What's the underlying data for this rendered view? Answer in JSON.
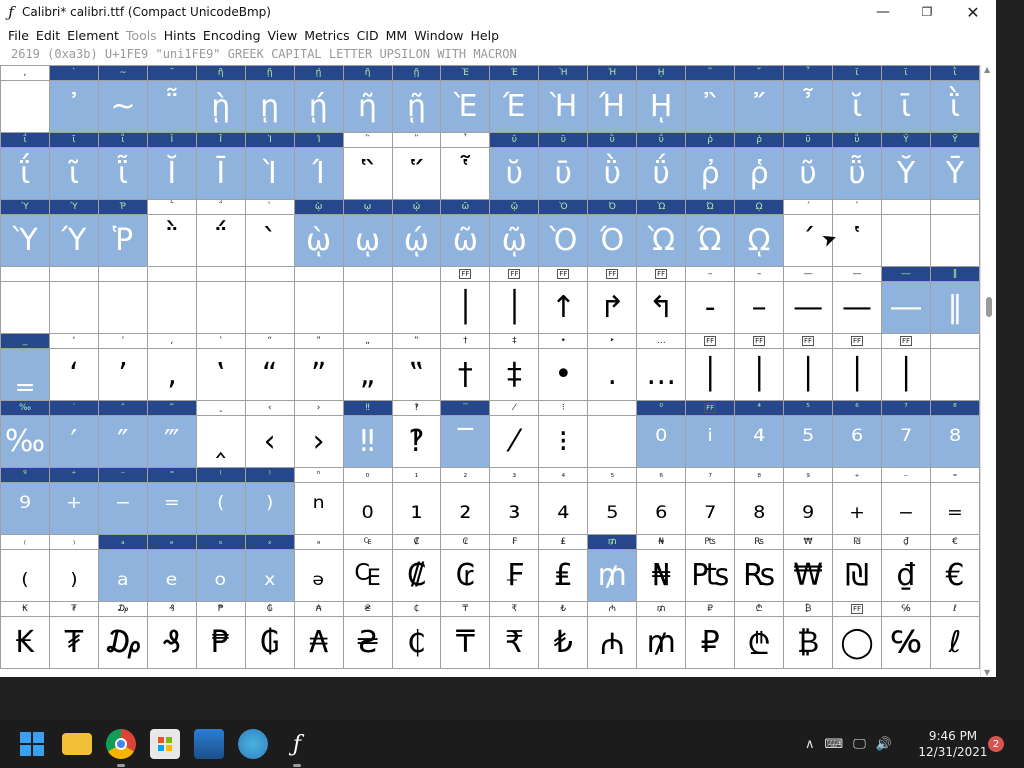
{
  "window": {
    "app_icon": "fontforge-icon",
    "title": "Calibri*  calibri.ttf (Compact UnicodeBmp)",
    "minimize_glyph": "—",
    "maximize_glyph": "❐",
    "close_glyph": "✕"
  },
  "menu": [
    {
      "label": "File",
      "enabled": true
    },
    {
      "label": "Edit",
      "enabled": true
    },
    {
      "label": "Element",
      "enabled": true
    },
    {
      "label": "Tools",
      "enabled": false
    },
    {
      "label": "Hints",
      "enabled": true
    },
    {
      "label": "Encoding",
      "enabled": true
    },
    {
      "label": "View",
      "enabled": true
    },
    {
      "label": "Metrics",
      "enabled": true
    },
    {
      "label": "CID",
      "enabled": true
    },
    {
      "label": "MM",
      "enabled": true
    },
    {
      "label": "Window",
      "enabled": true
    },
    {
      "label": "Help",
      "enabled": true
    }
  ],
  "info_line": "2619 (0xa3b) U+1FE9 \"uni1FE9\" GREEK CAPITAL LETTER UPSILON WITH MACRON",
  "grid": {
    "columns": 20,
    "rows": [
      {
        "labels": [
          ",",
          "`",
          "~",
          "῀",
          "ῆ",
          "ῇ",
          "ῄ",
          "ῆ",
          "ῇ",
          "Ὲ",
          "Έ",
          "Ὴ",
          "Ή",
          "ῌ",
          "῍",
          "῎",
          "῏",
          "ῐ",
          "ῑ",
          "ῒ"
        ],
        "glyphs": [
          "",
          "᾿",
          "~",
          "῁",
          "ῂ",
          "ῃ",
          "ῄ",
          "ῆ",
          "ῇ",
          "Ὲ",
          "Έ",
          "Ὴ",
          "Ή",
          "ῌ",
          "῍",
          "῎",
          "῏",
          "ῐ",
          "ῑ",
          "ῒ"
        ],
        "selected": [
          false,
          true,
          true,
          true,
          true,
          true,
          true,
          true,
          true,
          true,
          true,
          true,
          true,
          true,
          true,
          true,
          true,
          true,
          true,
          true
        ]
      },
      {
        "labels": [
          "ΐ",
          "ῖ",
          "ῗ",
          "Ῐ",
          "Ῑ",
          "Ὶ",
          "Ί",
          "῝",
          "῞",
          "῟",
          "ῠ",
          "ῡ",
          "ῢ",
          "ΰ",
          "ῤ",
          "ῥ",
          "ῦ",
          "ῧ",
          "Ῠ",
          "Ῡ"
        ],
        "glyphs": [
          "ΐ",
          "ῖ",
          "ῗ",
          "Ῐ",
          "Ῑ",
          "Ὶ",
          "Ί",
          "῝",
          "῞",
          "῟",
          "ῠ",
          "ῡ",
          "ῢ",
          "ΰ",
          "ῤ",
          "ῥ",
          "ῦ",
          "ῧ",
          "Ῠ",
          "Ῡ"
        ],
        "selected": [
          true,
          true,
          true,
          true,
          true,
          true,
          true,
          false,
          false,
          false,
          true,
          true,
          true,
          true,
          true,
          true,
          true,
          true,
          true,
          true
        ]
      },
      {
        "labels": [
          "Ὺ",
          "Ύ",
          "Ῥ",
          "῭",
          "΅",
          "`",
          "ῲ",
          "ῳ",
          "ῴ",
          "ῶ",
          "ῷ",
          "Ὸ",
          "Ό",
          "Ὼ",
          "Ώ",
          "ῼ",
          "´",
          "῾",
          "",
          ""
        ],
        "glyphs": [
          "Ὺ",
          "Ύ",
          "Ῥ",
          "῭",
          "΅",
          "`",
          "ῲ",
          "ῳ",
          "ῴ",
          "ῶ",
          "ῷ",
          "Ὸ",
          "Ό",
          "Ὼ",
          "Ώ",
          "ῼ",
          "´",
          "῾",
          "",
          ""
        ],
        "selected": [
          true,
          true,
          true,
          false,
          false,
          false,
          true,
          true,
          true,
          true,
          true,
          true,
          true,
          true,
          true,
          true,
          false,
          false,
          false,
          false
        ]
      },
      {
        "labels": [
          "",
          "",
          "",
          "",
          "",
          "",
          "",
          "",
          "",
          "FF",
          "FF",
          "FF",
          "FF",
          "FF",
          "–",
          "–",
          "—",
          "—",
          "―",
          "‖"
        ],
        "glyphs": [
          "",
          "",
          "",
          "",
          "",
          "",
          "",
          "",
          "",
          "│",
          "│",
          "↑",
          "↱",
          "↰",
          "-",
          "–",
          "—",
          "—",
          "―",
          "‖"
        ],
        "selected": [
          false,
          false,
          false,
          false,
          false,
          false,
          false,
          false,
          false,
          false,
          false,
          false,
          false,
          false,
          false,
          false,
          false,
          false,
          true,
          true
        ]
      },
      {
        "labels": [
          "_",
          "‘",
          "’",
          "‚",
          "‛",
          "“",
          "”",
          "„",
          "‟",
          "†",
          "‡",
          "•",
          "‣",
          "…",
          "FF",
          "FF",
          "FF",
          "FF",
          "FF",
          ""
        ],
        "glyphs": [
          "‗",
          "‘",
          "’",
          "‚",
          "‛",
          "“",
          "”",
          "„",
          "‟",
          "†",
          "‡",
          "•",
          ".",
          "…",
          "│",
          "│",
          "│",
          "│",
          "│",
          ""
        ],
        "selected": [
          true,
          false,
          false,
          false,
          false,
          false,
          false,
          false,
          false,
          false,
          false,
          false,
          false,
          false,
          false,
          false,
          false,
          false,
          false,
          false
        ]
      },
      {
        "labels": [
          "‰",
          "′",
          "″",
          "‴",
          "‸",
          "‹",
          "›",
          "‼",
          "‽",
          "‾",
          "⁄",
          "⁝",
          "",
          "⁰",
          "FF",
          "⁴",
          "⁵",
          "⁶",
          "⁷",
          "⁸"
        ],
        "glyphs": [
          "‰",
          "′",
          "″",
          "‴",
          "‸",
          "‹",
          "›",
          "‼",
          "‽",
          "‾",
          "⁄",
          "⁝",
          "",
          "⁰",
          "ⁱ",
          "⁴",
          "⁵",
          "⁶",
          "⁷",
          "⁸"
        ],
        "selected": [
          true,
          true,
          true,
          true,
          false,
          false,
          false,
          true,
          false,
          true,
          false,
          false,
          false,
          true,
          true,
          true,
          true,
          true,
          true,
          true
        ]
      },
      {
        "labels": [
          "⁹",
          "⁺",
          "⁻",
          "⁼",
          "⁽",
          "⁾",
          "ⁿ",
          "₀",
          "₁",
          "₂",
          "₃",
          "₄",
          "₅",
          "₆",
          "₇",
          "₈",
          "₉",
          "₊",
          "₋",
          "₌"
        ],
        "glyphs": [
          "⁹",
          "⁺",
          "⁻",
          "⁼",
          "⁽",
          "⁾",
          "ⁿ",
          "₀",
          "₁",
          "₂",
          "₃",
          "₄",
          "₅",
          "₆",
          "₇",
          "₈",
          "₉",
          "₊",
          "₋",
          "₌"
        ],
        "selected": [
          true,
          true,
          true,
          true,
          true,
          true,
          false,
          false,
          false,
          false,
          false,
          false,
          false,
          false,
          false,
          false,
          false,
          false,
          false,
          false
        ]
      },
      {
        "labels": [
          "₍",
          "₎",
          "ₐ",
          "ₑ",
          "ₒ",
          "ₓ",
          "ₔ",
          "₠",
          "₡",
          "₢",
          "₣",
          "₤",
          "₥",
          "₦",
          "₧",
          "₨",
          "₩",
          "₪",
          "₫",
          "€"
        ],
        "glyphs": [
          "₍",
          "₎",
          "ₐ",
          "ₑ",
          "ₒ",
          "ₓ",
          "ₔ",
          "₠",
          "₡",
          "₢",
          "₣",
          "₤",
          "₥",
          "₦",
          "₧",
          "₨",
          "₩",
          "₪",
          "₫",
          "€"
        ],
        "selected": [
          false,
          false,
          true,
          true,
          true,
          true,
          false,
          false,
          false,
          false,
          false,
          false,
          true,
          false,
          false,
          false,
          false,
          false,
          false,
          false
        ]
      },
      {
        "labels": [
          "₭",
          "₮",
          "₯",
          "₰",
          "₱",
          "₲",
          "₳",
          "₴",
          "₵",
          "₸",
          "₹",
          "₺",
          "₼",
          "₥",
          "₽",
          "₾",
          "₿",
          "FF",
          "℅",
          "ℓ"
        ],
        "glyphs": [
          "₭",
          "₮",
          "₯",
          "₰",
          "₱",
          "₲",
          "₳",
          "₴",
          "₵",
          "₸",
          "₹",
          "₺",
          "₼",
          "₥",
          "₽",
          "₾",
          "₿",
          "◯",
          "℅",
          "ℓ"
        ],
        "selected": [
          false,
          false,
          false,
          false,
          false,
          false,
          false,
          false,
          false,
          false,
          false,
          false,
          false,
          false,
          false,
          false,
          false,
          false,
          false,
          false
        ]
      }
    ]
  },
  "scrollbar": {
    "up": "▲",
    "down": "▼",
    "position": 0.37
  },
  "taskbar": {
    "icons": [
      "windows-start-icon",
      "file-explorer-icon",
      "chrome-icon",
      "microsoft-store-icon",
      "photos-icon",
      "maps-icon",
      "fontforge-icon"
    ],
    "tray": {
      "chevron": "∧",
      "keyboard": "⌨",
      "network": "🖵",
      "volume": "🔊"
    },
    "time": "9:46 PM",
    "date": "12/31/2021",
    "notifications": "2"
  }
}
